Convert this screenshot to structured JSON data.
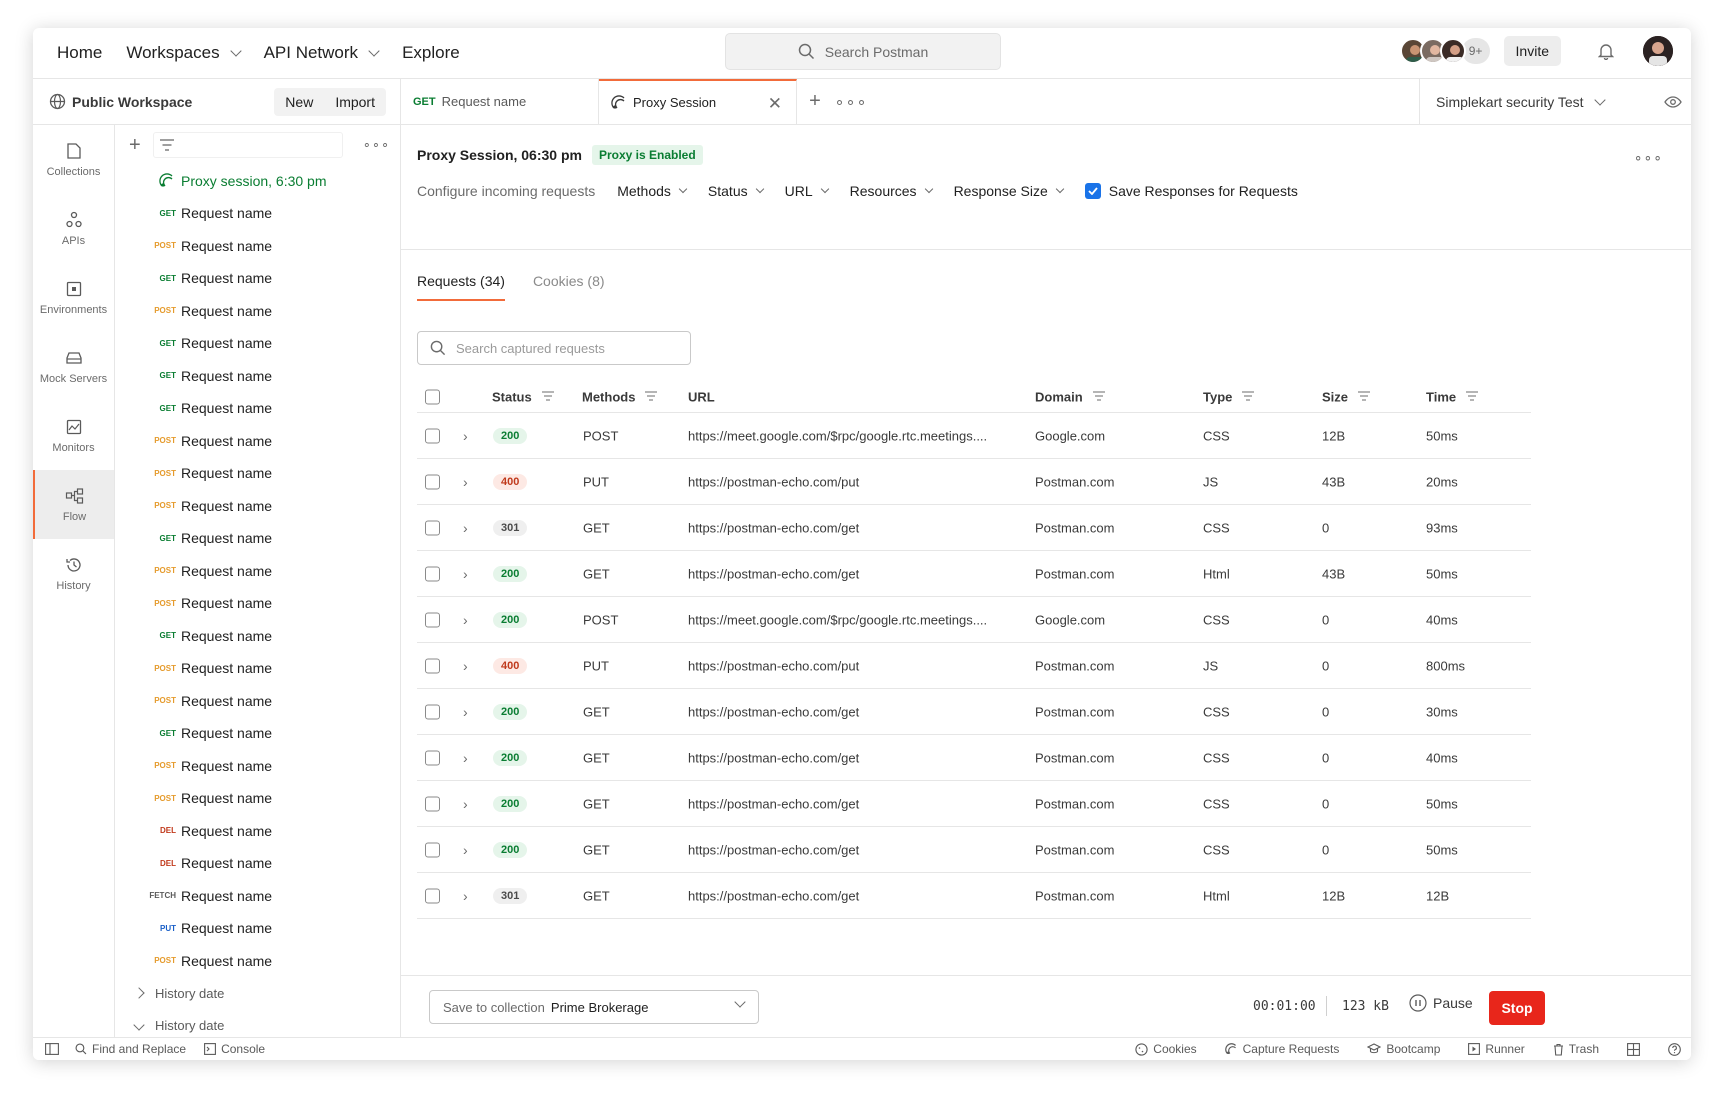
{
  "topnav": {
    "home": "Home",
    "workspaces": "Workspaces",
    "api_network": "API Network",
    "explore": "Explore",
    "search_placeholder": "Search Postman",
    "avatars_more": "9+",
    "invite": "Invite"
  },
  "workspace": {
    "title": "Public Workspace",
    "new": "New",
    "import": "Import"
  },
  "tabs": [
    {
      "method": "GET",
      "label": "Request name"
    },
    {
      "label": "Proxy Session"
    }
  ],
  "environment": "Simplekart security Test",
  "rail": [
    {
      "label": "Collections"
    },
    {
      "label": "APIs"
    },
    {
      "label": "Environments"
    },
    {
      "label": "Mock Servers"
    },
    {
      "label": "Monitors"
    },
    {
      "label": "Flow"
    },
    {
      "label": "History"
    }
  ],
  "tree": {
    "session": "Proxy session, 6:30 pm",
    "requests": [
      {
        "method": "GET",
        "label": "Request name"
      },
      {
        "method": "POST",
        "label": "Request name"
      },
      {
        "method": "GET",
        "label": "Request name"
      },
      {
        "method": "POST",
        "label": "Request name"
      },
      {
        "method": "GET",
        "label": "Request name"
      },
      {
        "method": "GET",
        "label": "Request name"
      },
      {
        "method": "GET",
        "label": "Request name"
      },
      {
        "method": "POST",
        "label": "Request name"
      },
      {
        "method": "POST",
        "label": "Request name"
      },
      {
        "method": "POST",
        "label": "Request name"
      },
      {
        "method": "GET",
        "label": "Request name"
      },
      {
        "method": "POST",
        "label": "Request name"
      },
      {
        "method": "POST",
        "label": "Request name"
      },
      {
        "method": "GET",
        "label": "Request name"
      },
      {
        "method": "POST",
        "label": "Request name"
      },
      {
        "method": "POST",
        "label": "Request name"
      },
      {
        "method": "GET",
        "label": "Request name"
      },
      {
        "method": "POST",
        "label": "Request name"
      },
      {
        "method": "POST",
        "label": "Request name"
      },
      {
        "method": "DEL",
        "label": "Request name"
      },
      {
        "method": "DEL",
        "label": "Request name"
      },
      {
        "method": "FETCH",
        "label": "Request name"
      },
      {
        "method": "PUT",
        "label": "Request name"
      },
      {
        "method": "POST",
        "label": "Request name"
      }
    ],
    "history": [
      "History date",
      "History date"
    ]
  },
  "proxy": {
    "title": "Proxy Session, 06:30 pm",
    "badge": "Proxy is Enabled",
    "configure": "Configure incoming requests",
    "filters": [
      "Methods",
      "Status",
      "URL",
      "Resources",
      "Response Size"
    ],
    "save_responses": "Save Responses for Requests",
    "tab_requests": "Requests (34)",
    "tab_cookies": "Cookies (8)",
    "search_placeholder": "Search captured requests"
  },
  "table": {
    "headers": {
      "status": "Status",
      "methods": "Methods",
      "url": "URL",
      "domain": "Domain",
      "type": "Type",
      "size": "Size",
      "time": "Time"
    },
    "rows": [
      {
        "status": "200",
        "method": "POST",
        "url": "https://meet.google.com/$rpc/google.rtc.meetings....",
        "domain": "Google.com",
        "type": "CSS",
        "size": "12B",
        "time": "50ms"
      },
      {
        "status": "400",
        "method": "PUT",
        "url": "https://postman-echo.com/put",
        "domain": "Postman.com",
        "type": "JS",
        "size": "43B",
        "time": "20ms"
      },
      {
        "status": "301",
        "method": "GET",
        "url": "https://postman-echo.com/get",
        "domain": "Postman.com",
        "type": "CSS",
        "size": "0",
        "time": "93ms"
      },
      {
        "status": "200",
        "method": "GET",
        "url": "https://postman-echo.com/get",
        "domain": "Postman.com",
        "type": "Html",
        "size": "43B",
        "time": "50ms"
      },
      {
        "status": "200",
        "method": "POST",
        "url": "https://meet.google.com/$rpc/google.rtc.meetings....",
        "domain": "Google.com",
        "type": "CSS",
        "size": "0",
        "time": "40ms"
      },
      {
        "status": "400",
        "method": "PUT",
        "url": "https://postman-echo.com/put",
        "domain": "Postman.com",
        "type": "JS",
        "size": "0",
        "time": "800ms"
      },
      {
        "status": "200",
        "method": "GET",
        "url": "https://postman-echo.com/get",
        "domain": "Postman.com",
        "type": "CSS",
        "size": "0",
        "time": "30ms"
      },
      {
        "status": "200",
        "method": "GET",
        "url": "https://postman-echo.com/get",
        "domain": "Postman.com",
        "type": "CSS",
        "size": "0",
        "time": "40ms"
      },
      {
        "status": "200",
        "method": "GET",
        "url": "https://postman-echo.com/get",
        "domain": "Postman.com",
        "type": "CSS",
        "size": "0",
        "time": "50ms"
      },
      {
        "status": "200",
        "method": "GET",
        "url": "https://postman-echo.com/get",
        "domain": "Postman.com",
        "type": "CSS",
        "size": "0",
        "time": "50ms"
      },
      {
        "status": "301",
        "method": "GET",
        "url": "https://postman-echo.com/get",
        "domain": "Postman.com",
        "type": "Html",
        "size": "12B",
        "time": "12B"
      }
    ]
  },
  "footer": {
    "save_label": "Save to collection",
    "collection": "Prime Brokerage",
    "timer": "00:01:00",
    "size": "123 kB",
    "pause": "Pause",
    "stop": "Stop"
  },
  "statusbar": {
    "find_replace": "Find and Replace",
    "console": "Console",
    "cookies": "Cookies",
    "capture": "Capture Requests",
    "bootcamp": "Bootcamp",
    "runner": "Runner",
    "trash": "Trash"
  },
  "colors": {
    "accent": "#f26b3a",
    "get": "#0a7d32",
    "post": "#e59b2d",
    "put": "#1a5fc8",
    "del": "#c0391b",
    "stop": "#e8261b",
    "checkbox": "#1a73e8"
  }
}
